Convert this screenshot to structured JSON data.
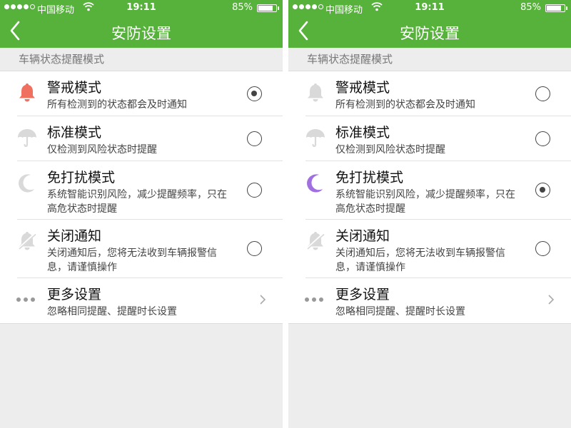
{
  "status": {
    "carrier": "中国移动",
    "time": "19:11",
    "battery": "85%",
    "battery_level": 0.85,
    "signal_bars": 4,
    "signal_max": 5
  },
  "nav": {
    "title": "安防设置"
  },
  "section_label": "车辆状态提醒模式",
  "items": [
    {
      "title": "警戒模式",
      "desc": "所有检测到的状态都会及时通知",
      "icon": "bell-icon"
    },
    {
      "title": "标准模式",
      "desc": "仅检测到风险状态时提醒",
      "icon": "umbrella-icon"
    },
    {
      "title": "免打扰模式",
      "desc": "系统智能识别风险，减少提醒频率，只在高危状态时提醒",
      "icon": "moon-icon"
    },
    {
      "title": "关闭通知",
      "desc": "关闭通知后，您将无法收到车辆报警信息，请谨慎操作",
      "icon": "bell-off-icon"
    },
    {
      "title": "更多设置",
      "desc": "忽略相同提醒、提醒时长设置",
      "icon": "more-dots-icon"
    }
  ],
  "screens": [
    {
      "selected_index": 0
    },
    {
      "selected_index": 2
    }
  ],
  "colors": {
    "header": "#56b23a",
    "bell_active": "#f07060",
    "moon_active": "#a070e0",
    "icon_inactive": "#d9d9d9"
  }
}
